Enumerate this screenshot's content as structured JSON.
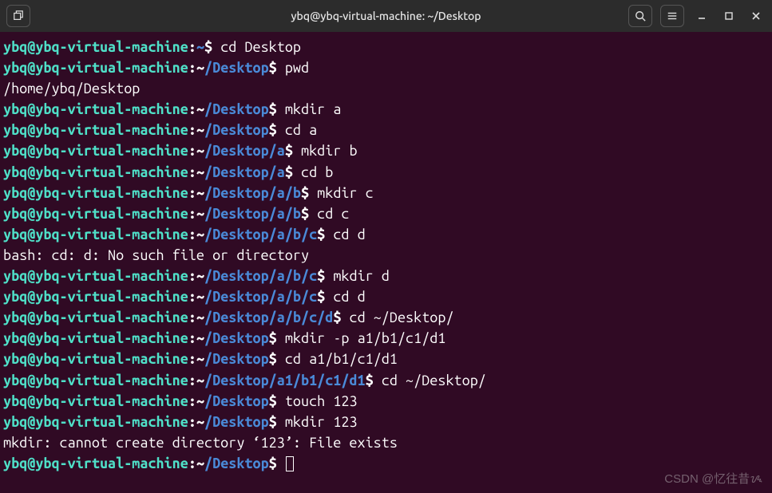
{
  "titlebar": {
    "title": "ybq@ybq-virtual-machine: ~/Desktop",
    "new_tab_icon": "⧉",
    "search_icon": "search",
    "menu_icon": "menu",
    "minimize_label": "–",
    "maximize_label": "□",
    "close_label": "×"
  },
  "prompt": {
    "user": "ybq@ybq-virtual-machine",
    "sep": ":",
    "dollar": "$"
  },
  "lines": [
    {
      "type": "prompt",
      "path": "~",
      "cmd": "cd Desktop"
    },
    {
      "type": "prompt",
      "path": "~/Desktop",
      "cmd": "pwd"
    },
    {
      "type": "output",
      "text": "/home/ybq/Desktop"
    },
    {
      "type": "prompt",
      "path": "~/Desktop",
      "cmd": "mkdir a"
    },
    {
      "type": "prompt",
      "path": "~/Desktop",
      "cmd": "cd a"
    },
    {
      "type": "prompt",
      "path": "~/Desktop/a",
      "cmd": "mkdir b"
    },
    {
      "type": "prompt",
      "path": "~/Desktop/a",
      "cmd": "cd b"
    },
    {
      "type": "prompt",
      "path": "~/Desktop/a/b",
      "cmd": "mkdir c"
    },
    {
      "type": "prompt",
      "path": "~/Desktop/a/b",
      "cmd": "cd c"
    },
    {
      "type": "prompt",
      "path": "~/Desktop/a/b/c",
      "cmd": "cd d"
    },
    {
      "type": "output",
      "text": "bash: cd: d: No such file or directory"
    },
    {
      "type": "prompt",
      "path": "~/Desktop/a/b/c",
      "cmd": "mkdir d"
    },
    {
      "type": "prompt",
      "path": "~/Desktop/a/b/c",
      "cmd": "cd d"
    },
    {
      "type": "prompt",
      "path": "~/Desktop/a/b/c/d",
      "cmd": "cd ~/Desktop/"
    },
    {
      "type": "prompt",
      "path": "~/Desktop",
      "cmd": "mkdir -p a1/b1/c1/d1"
    },
    {
      "type": "prompt",
      "path": "~/Desktop",
      "cmd": "cd a1/b1/c1/d1"
    },
    {
      "type": "prompt",
      "path": "~/Desktop/a1/b1/c1/d1",
      "cmd": "cd ~/Desktop/"
    },
    {
      "type": "prompt",
      "path": "~/Desktop",
      "cmd": "touch 123"
    },
    {
      "type": "prompt",
      "path": "~/Desktop",
      "cmd": "mkdir 123"
    },
    {
      "type": "output",
      "text": "mkdir: cannot create directory ‘123’: File exists"
    },
    {
      "type": "prompt",
      "path": "~/Desktop",
      "cmd": "",
      "cursor": true
    }
  ],
  "watermark": "CSDN @忆往昔ᝰ"
}
